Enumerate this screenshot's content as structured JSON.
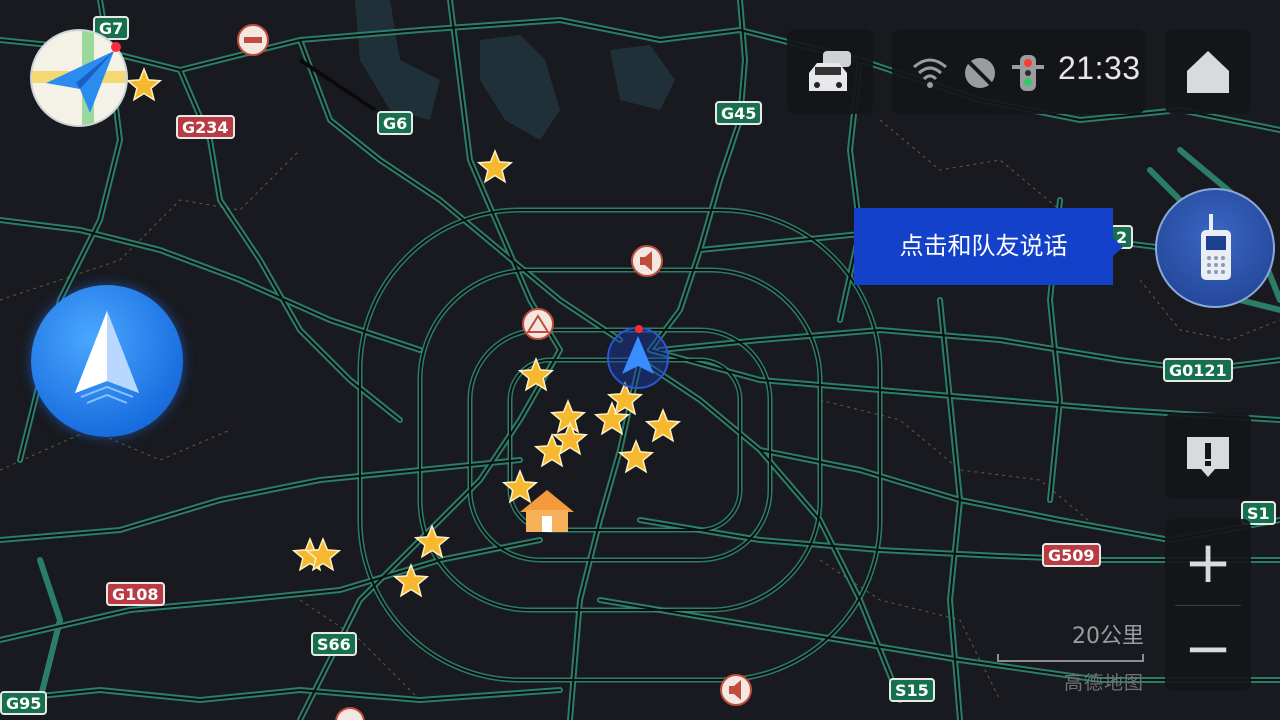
{
  "map": {
    "road_labels": [
      {
        "text": "G7",
        "kind": "exp"
      },
      {
        "text": "G234",
        "kind": "nat"
      },
      {
        "text": "G6",
        "kind": "exp"
      },
      {
        "text": "G45",
        "kind": "exp"
      },
      {
        "text": "G0121",
        "kind": "exp"
      },
      {
        "text": "G509",
        "kind": "nat"
      },
      {
        "text": "G108",
        "kind": "nat"
      },
      {
        "text": "S66",
        "kind": "exp"
      },
      {
        "text": "S15",
        "kind": "exp"
      },
      {
        "text": "G95",
        "kind": "exp"
      },
      {
        "text": "S1",
        "kind": "exp"
      },
      {
        "text": "2",
        "kind": "exp"
      }
    ],
    "colors": {
      "background": "#181a1f",
      "road_clear": "#2f8f74",
      "road_dark": "#0c0d10",
      "favorite": "#f5b82e",
      "national_road": "#b83a42",
      "expressway": "#16704e"
    }
  },
  "status_bar": {
    "time": "21:33",
    "icons": [
      "traffic-cars-icon",
      "wifi-icon",
      "gps-off-icon",
      "traffic-light-icon",
      "home-icon"
    ]
  },
  "talk_tip": {
    "text": "点击和队友说话"
  },
  "controls": {
    "zoom_in": "+",
    "zoom_out": "−",
    "report_icon": "report-issue-icon",
    "walkie_icon": "walkie-talkie-icon",
    "nav_icon": "navigate-arrow-icon"
  },
  "scale": {
    "text": "20公里"
  },
  "brand": {
    "text": "高德地图"
  }
}
